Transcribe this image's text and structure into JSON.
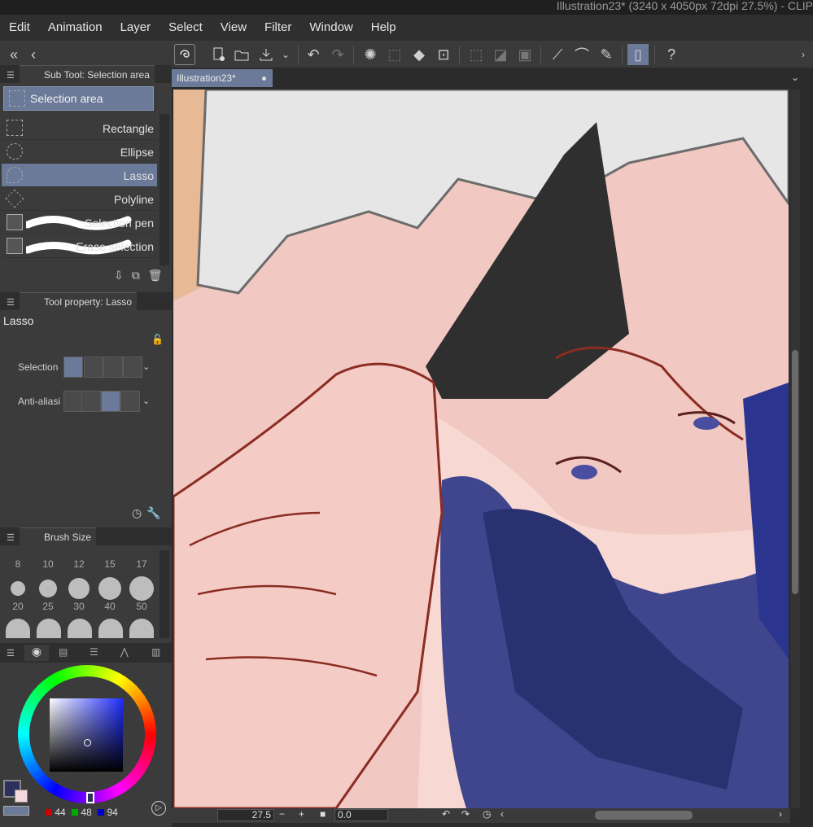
{
  "window": {
    "title": "Illustration23* (3240 x 4050px 72dpi 27.5%)  - CLIP"
  },
  "menu": [
    "Edit",
    "Animation",
    "Layer",
    "Select",
    "View",
    "Filter",
    "Window",
    "Help"
  ],
  "subtool_panel": {
    "title": "Sub Tool: Selection area",
    "group": "Selection area",
    "items": [
      "Rectangle",
      "Ellipse",
      "Lasso",
      "Polyline",
      "Selection pen",
      "Erase selection"
    ],
    "selected": "Lasso"
  },
  "tool_property": {
    "title": "Tool property: Lasso",
    "name": "Lasso",
    "selection_mode_label": "Selection m",
    "anti_alias_label": "Anti-aliasin"
  },
  "brush_size": {
    "title": "Brush Size",
    "sizes_row1": [
      "8",
      "10",
      "12",
      "15",
      "17"
    ],
    "sizes_row2": [
      "20",
      "25",
      "30",
      "40",
      "50"
    ]
  },
  "color": {
    "r": "44",
    "g": "48",
    "b": "94",
    "main_color": "#2c305e",
    "accent": "#6b7a98"
  },
  "document": {
    "tab": "Illustration23*"
  },
  "status": {
    "zoom": "27.5",
    "rotation": "0.0"
  }
}
